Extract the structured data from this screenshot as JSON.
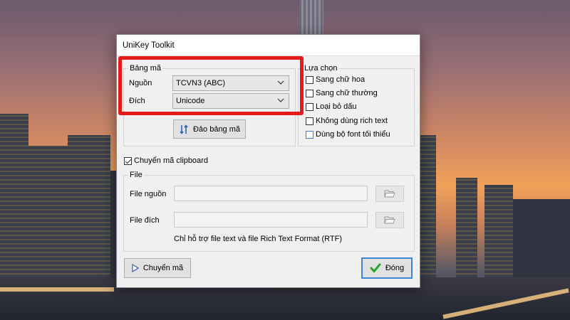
{
  "window": {
    "title": "UniKey Toolkit"
  },
  "charset_group": {
    "legend": "Bảng mã",
    "source_label": "Nguồn",
    "source_value": "TCVN3 (ABC)",
    "dest_label": "Đích",
    "dest_value": "Unicode",
    "swap_button": "Đảo bảng mã"
  },
  "options_group": {
    "legend": "Lựa chọn",
    "items": [
      {
        "label": "Sang chữ hoa",
        "checked": false
      },
      {
        "label": "Sang chữ thường",
        "checked": false
      },
      {
        "label": "Loại bỏ dấu",
        "checked": false
      },
      {
        "label": "Không dùng rich text",
        "checked": false
      },
      {
        "label": "Dùng bộ font tối thiểu",
        "checked": false
      }
    ]
  },
  "clipboard_option": {
    "label": "Chuyển mã clipboard",
    "checked": true
  },
  "file_group": {
    "legend": "File",
    "source_label": "File nguồn",
    "source_value": "",
    "dest_label": "File đích",
    "dest_value": "",
    "note": "Chỉ hỗ trợ file text và file Rich Text Format (RTF)"
  },
  "buttons": {
    "convert": "Chuyển mã",
    "close": "Đóng"
  },
  "colors": {
    "highlight": "#e31b1b",
    "default_button_border": "#3c86d6",
    "check_green": "#2aa52a"
  },
  "icons": [
    "swap-arrows-icon",
    "folder-open-icon",
    "play-arrow-icon",
    "green-check-icon",
    "chevron-down-icon"
  ]
}
